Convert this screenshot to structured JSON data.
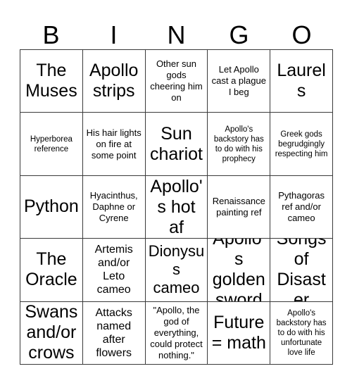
{
  "card": {
    "header_letters": [
      "B",
      "I",
      "N",
      "G",
      "O"
    ],
    "rows": [
      [
        {
          "text": "The Muses",
          "size": "xl"
        },
        {
          "text": "Apollo strips",
          "size": "xl"
        },
        {
          "text": "Other sun gods cheering him on",
          "size": "sm"
        },
        {
          "text": "Let Apollo cast a plague I beg",
          "size": "sm"
        },
        {
          "text": "Laurels",
          "size": "xl"
        }
      ],
      [
        {
          "text": "Hyperborea reference",
          "size": "xs"
        },
        {
          "text": "His hair lights on fire at some point",
          "size": "sm"
        },
        {
          "text": "Sun chariot",
          "size": "xl"
        },
        {
          "text": "Apollo's backstory has to do with his prophecy",
          "size": "xs"
        },
        {
          "text": "Greek gods begrudgingly respecting him",
          "size": "xs"
        }
      ],
      [
        {
          "text": "Python",
          "size": "xl"
        },
        {
          "text": "Hyacinthus, Daphne or Cyrene",
          "size": "sm"
        },
        {
          "text": "Apollo's hot af",
          "size": "xl"
        },
        {
          "text": "Renaissance painting ref",
          "size": "sm"
        },
        {
          "text": "Pythagoras ref and/or cameo",
          "size": "sm"
        }
      ],
      [
        {
          "text": "The Oracle",
          "size": "xl"
        },
        {
          "text": "Artemis and/or Leto cameo",
          "size": "md"
        },
        {
          "text": "Dionysus cameo",
          "size": "lg"
        },
        {
          "text": "Apollo's golden sword",
          "size": "xl"
        },
        {
          "text": "Songs of Disaster",
          "size": "xl"
        }
      ],
      [
        {
          "text": "Swans and/or crows",
          "size": "xl"
        },
        {
          "text": "Attacks named after flowers",
          "size": "md"
        },
        {
          "text": "\"Apollo, the god of everything, could protect nothing.\"",
          "size": "sm"
        },
        {
          "text": "Future = math",
          "size": "xl"
        },
        {
          "text": "Apollo's backstory has to do with his unfortunate love life",
          "size": "xs"
        }
      ]
    ]
  },
  "colors": {
    "background": "#ffffff",
    "text": "#000000",
    "grid_line": "#3a3a3a"
  }
}
